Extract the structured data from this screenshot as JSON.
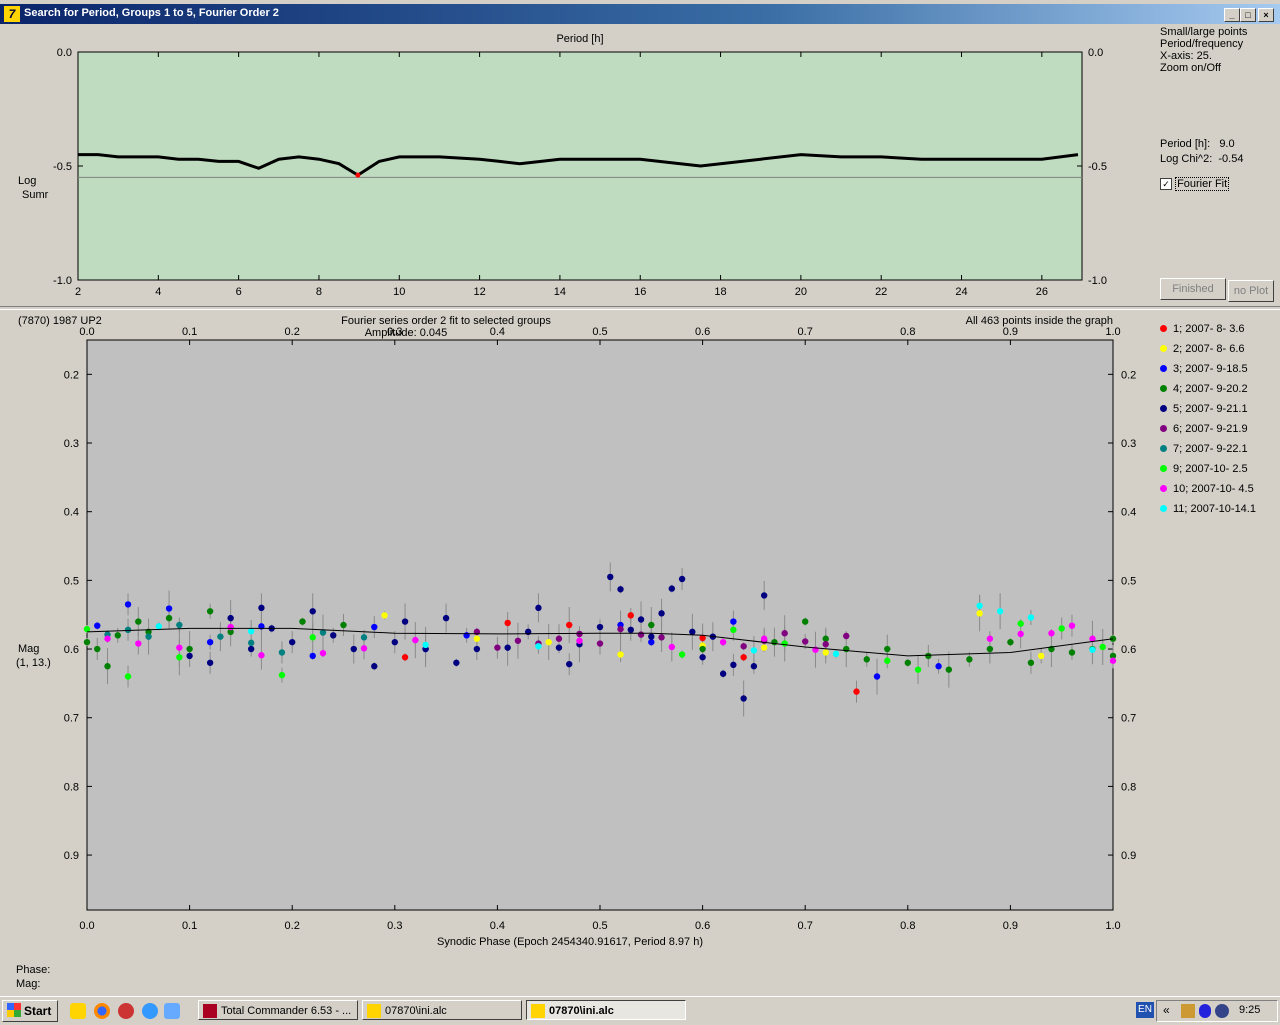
{
  "window": {
    "title": "Search for Period, Groups 1 to 5, Fourier Order 2"
  },
  "top_chart": {
    "xlabel": "Period [h]",
    "ylabel_line1": "Log",
    "ylabel_line2": "Sumr",
    "x_range": [
      2,
      27
    ],
    "y_range": [
      -1.0,
      0.0
    ],
    "x_ticks": [
      "2",
      "4",
      "6",
      "8",
      "10",
      "12",
      "14",
      "16",
      "18",
      "20",
      "22",
      "24",
      "26"
    ],
    "y_ticks": [
      "0.0",
      "-0.5",
      "-1.0"
    ],
    "min_marker": {
      "x": 8.97,
      "y": -0.54
    },
    "reference_y": -0.55,
    "bg_color": "#c0dcc0"
  },
  "side_top": {
    "menu": [
      "Small/large points",
      "Period/frequency",
      "X-axis: 25.",
      "Zoom on/Off"
    ],
    "period_label": "Period [h]:",
    "period_value": "9.0",
    "chi_label": "Log Chi^2:",
    "chi_value": "-0.54",
    "fourier_fit_label": "Fourier Fit",
    "finished_button": "Finished",
    "noplot_button": "no Plot"
  },
  "bottom_chart": {
    "object": "(7870) 1987 UP2",
    "title_line1": "Fourier series order 2 fit to selected groups",
    "title_line2": "Amplitude: 0.045",
    "status": "All 463 points inside the graph",
    "xlabel": "Synodic Phase (Epoch 2454340.91617, Period 8.97 h)",
    "ylabel_line1": "Mag",
    "ylabel_line2": "(1, 13.)",
    "x_range": [
      0.0,
      1.0
    ],
    "y_range": [
      0.15,
      0.98
    ],
    "x_ticks": [
      "0.0",
      "0.1",
      "0.2",
      "0.3",
      "0.4",
      "0.5",
      "0.6",
      "0.7",
      "0.8",
      "0.9",
      "1.0"
    ],
    "y_ticks": [
      "0.2",
      "0.3",
      "0.4",
      "0.5",
      "0.6",
      "0.7",
      "0.8",
      "0.9"
    ]
  },
  "legend": [
    {
      "label": "1; 2007- 8- 3.6",
      "color": "#ff0000"
    },
    {
      "label": "2; 2007- 8- 6.6",
      "color": "#ffff00"
    },
    {
      "label": "3; 2007- 9-18.5",
      "color": "#0000ff"
    },
    {
      "label": "4; 2007- 9-20.2",
      "color": "#008000"
    },
    {
      "label": "5; 2007- 9-21.1",
      "color": "#000080"
    },
    {
      "label": "6; 2007- 9-21.9",
      "color": "#800080"
    },
    {
      "label": "7; 2007- 9-22.1",
      "color": "#008080"
    },
    {
      "label": "9; 2007-10- 2.5",
      "color": "#00ff00"
    },
    {
      "label": "10; 2007-10- 4.5",
      "color": "#ff00ff"
    },
    {
      "label": "11; 2007-10-14.1",
      "color": "#00ffff"
    }
  ],
  "status_bottom": {
    "phase_label": "Phase:",
    "mag_label": "Mag:"
  },
  "taskbar": {
    "start": "Start",
    "tasks": [
      "Total Commander 6.53 - ...",
      "07870\\ini.alc",
      "07870\\ini.alc"
    ],
    "lang": "EN",
    "clock": "9:25"
  },
  "chart_data": [
    {
      "type": "line",
      "title": "",
      "xlabel": "Period [h]",
      "ylabel": "Log Sumr",
      "xlim": [
        2,
        27
      ],
      "ylim": [
        -1.0,
        0.0
      ],
      "series": [
        {
          "values": [
            [
              2.0,
              -0.45
            ],
            [
              2.5,
              -0.45
            ],
            [
              3.0,
              -0.46
            ],
            [
              3.5,
              -0.46
            ],
            [
              4.0,
              -0.46
            ],
            [
              4.5,
              -0.47
            ],
            [
              5.0,
              -0.47
            ],
            [
              5.5,
              -0.48
            ],
            [
              6.0,
              -0.48
            ],
            [
              6.5,
              -0.51
            ],
            [
              7.0,
              -0.47
            ],
            [
              7.5,
              -0.46
            ],
            [
              8.0,
              -0.47
            ],
            [
              8.5,
              -0.49
            ],
            [
              8.97,
              -0.54
            ],
            [
              9.5,
              -0.48
            ],
            [
              10.0,
              -0.46
            ],
            [
              11.0,
              -0.46
            ],
            [
              12.0,
              -0.47
            ],
            [
              12.5,
              -0.48
            ],
            [
              13.0,
              -0.49
            ],
            [
              14.0,
              -0.47
            ],
            [
              15.0,
              -0.47
            ],
            [
              16.0,
              -0.47
            ],
            [
              17.0,
              -0.49
            ],
            [
              17.5,
              -0.5
            ],
            [
              18.0,
              -0.49
            ],
            [
              19.0,
              -0.47
            ],
            [
              20.0,
              -0.45
            ],
            [
              21.0,
              -0.46
            ],
            [
              22.0,
              -0.46
            ],
            [
              23.0,
              -0.47
            ],
            [
              24.0,
              -0.47
            ],
            [
              25.0,
              -0.47
            ],
            [
              26.0,
              -0.47
            ],
            [
              26.9,
              -0.45
            ]
          ]
        }
      ]
    },
    {
      "type": "scatter",
      "title": "Fourier series order 2 fit to selected groups",
      "xlabel": "Synodic Phase (Epoch 2454340.91617, Period 8.97 h)",
      "ylabel": "Mag (1, 13.)",
      "xlim": [
        0.0,
        1.0
      ],
      "ylim": [
        0.15,
        0.98
      ],
      "series": [
        {
          "name": "1; 2007- 8- 3.6",
          "color": "#ff0000",
          "values": [
            [
              0.31,
              0.612
            ],
            [
              0.41,
              0.562
            ],
            [
              0.47,
              0.565
            ],
            [
              0.53,
              0.551
            ],
            [
              0.6,
              0.584
            ],
            [
              0.64,
              0.612
            ],
            [
              0.75,
              0.662
            ]
          ]
        },
        {
          "name": "2; 2007- 8- 6.6",
          "color": "#ffff00",
          "values": [
            [
              0.29,
              0.551
            ],
            [
              0.38,
              0.585
            ],
            [
              0.45,
              0.59
            ],
            [
              0.52,
              0.608
            ],
            [
              0.6,
              0.595
            ],
            [
              0.66,
              0.598
            ],
            [
              0.72,
              0.605
            ],
            [
              0.87,
              0.548
            ],
            [
              0.93,
              0.61
            ]
          ]
        },
        {
          "name": "3; 2007- 9-18.5",
          "color": "#0000ff",
          "values": [
            [
              0.01,
              0.566
            ],
            [
              0.04,
              0.535
            ],
            [
              0.08,
              0.541
            ],
            [
              0.12,
              0.59
            ],
            [
              0.17,
              0.567
            ],
            [
              0.22,
              0.61
            ],
            [
              0.28,
              0.568
            ],
            [
              0.33,
              0.6
            ],
            [
              0.37,
              0.58
            ],
            [
              0.52,
              0.565
            ],
            [
              0.55,
              0.59
            ],
            [
              0.63,
              0.56
            ],
            [
              0.77,
              0.64
            ],
            [
              0.83,
              0.625
            ]
          ]
        },
        {
          "name": "4; 2007- 9-20.2",
          "color": "#008000",
          "values": [
            [
              0.0,
              0.59
            ],
            [
              0.01,
              0.6
            ],
            [
              0.02,
              0.625
            ],
            [
              0.03,
              0.58
            ],
            [
              0.05,
              0.56
            ],
            [
              0.06,
              0.575
            ],
            [
              0.08,
              0.555
            ],
            [
              0.1,
              0.6
            ],
            [
              0.12,
              0.545
            ],
            [
              0.14,
              0.575
            ],
            [
              0.21,
              0.56
            ],
            [
              0.25,
              0.565
            ],
            [
              0.55,
              0.565
            ],
            [
              0.6,
              0.6
            ],
            [
              0.67,
              0.59
            ],
            [
              0.7,
              0.56
            ],
            [
              0.72,
              0.585
            ],
            [
              0.74,
              0.6
            ],
            [
              0.76,
              0.615
            ],
            [
              0.78,
              0.6
            ],
            [
              0.8,
              0.62
            ],
            [
              0.82,
              0.61
            ],
            [
              0.84,
              0.63
            ],
            [
              0.86,
              0.615
            ],
            [
              0.88,
              0.6
            ],
            [
              0.9,
              0.59
            ],
            [
              0.92,
              0.62
            ],
            [
              0.94,
              0.6
            ],
            [
              0.96,
              0.605
            ],
            [
              0.98,
              0.6
            ],
            [
              1.0,
              0.585
            ],
            [
              1.0,
              0.61
            ]
          ]
        },
        {
          "name": "5; 2007- 9-21.1",
          "color": "#000080",
          "values": [
            [
              0.1,
              0.61
            ],
            [
              0.12,
              0.62
            ],
            [
              0.14,
              0.555
            ],
            [
              0.16,
              0.6
            ],
            [
              0.17,
              0.54
            ],
            [
              0.18,
              0.57
            ],
            [
              0.2,
              0.59
            ],
            [
              0.22,
              0.545
            ],
            [
              0.24,
              0.58
            ],
            [
              0.26,
              0.6
            ],
            [
              0.28,
              0.625
            ],
            [
              0.3,
              0.59
            ],
            [
              0.31,
              0.56
            ],
            [
              0.33,
              0.6
            ],
            [
              0.35,
              0.555
            ],
            [
              0.36,
              0.62
            ],
            [
              0.38,
              0.6
            ],
            [
              0.41,
              0.598
            ],
            [
              0.43,
              0.575
            ],
            [
              0.44,
              0.54
            ],
            [
              0.46,
              0.598
            ],
            [
              0.47,
              0.622
            ],
            [
              0.48,
              0.593
            ],
            [
              0.5,
              0.568
            ],
            [
              0.51,
              0.495
            ],
            [
              0.52,
              0.513
            ],
            [
              0.53,
              0.572
            ],
            [
              0.54,
              0.557
            ],
            [
              0.55,
              0.582
            ],
            [
              0.56,
              0.548
            ],
            [
              0.57,
              0.512
            ],
            [
              0.58,
              0.498
            ],
            [
              0.59,
              0.575
            ],
            [
              0.6,
              0.612
            ],
            [
              0.61,
              0.582
            ],
            [
              0.62,
              0.636
            ],
            [
              0.63,
              0.623
            ],
            [
              0.64,
              0.672
            ],
            [
              0.65,
              0.625
            ],
            [
              0.66,
              0.522
            ]
          ]
        },
        {
          "name": "6; 2007- 9-21.9",
          "color": "#800080",
          "values": [
            [
              0.38,
              0.575
            ],
            [
              0.4,
              0.598
            ],
            [
              0.42,
              0.588
            ],
            [
              0.44,
              0.592
            ],
            [
              0.46,
              0.585
            ],
            [
              0.48,
              0.578
            ],
            [
              0.5,
              0.592
            ],
            [
              0.52,
              0.571
            ],
            [
              0.54,
              0.579
            ],
            [
              0.56,
              0.583
            ],
            [
              0.64,
              0.596
            ],
            [
              0.66,
              0.588
            ],
            [
              0.68,
              0.577
            ],
            [
              0.7,
              0.589
            ],
            [
              0.72,
              0.593
            ],
            [
              0.74,
              0.581
            ]
          ]
        },
        {
          "name": "7; 2007- 9-22.1",
          "color": "#008080",
          "values": [
            [
              0.02,
              0.579
            ],
            [
              0.04,
              0.572
            ],
            [
              0.06,
              0.582
            ],
            [
              0.09,
              0.565
            ],
            [
              0.13,
              0.582
            ],
            [
              0.16,
              0.591
            ],
            [
              0.19,
              0.605
            ],
            [
              0.23,
              0.576
            ],
            [
              0.27,
              0.583
            ]
          ]
        },
        {
          "name": "9; 2007-10- 2.5",
          "color": "#00ff00",
          "values": [
            [
              0.0,
              0.571
            ],
            [
              0.04,
              0.64
            ],
            [
              0.09,
              0.612
            ],
            [
              0.19,
              0.638
            ],
            [
              0.22,
              0.583
            ],
            [
              0.58,
              0.608
            ],
            [
              0.63,
              0.572
            ],
            [
              0.68,
              0.592
            ],
            [
              0.78,
              0.617
            ],
            [
              0.81,
              0.63
            ],
            [
              0.91,
              0.563
            ],
            [
              0.95,
              0.57
            ],
            [
              0.99,
              0.597
            ]
          ]
        },
        {
          "name": "10; 2007-10- 4.5",
          "color": "#ff00ff",
          "values": [
            [
              0.02,
              0.585
            ],
            [
              0.05,
              0.592
            ],
            [
              0.09,
              0.598
            ],
            [
              0.14,
              0.568
            ],
            [
              0.17,
              0.609
            ],
            [
              0.23,
              0.606
            ],
            [
              0.27,
              0.599
            ],
            [
              0.32,
              0.587
            ],
            [
              0.48,
              0.588
            ],
            [
              0.57,
              0.597
            ],
            [
              0.62,
              0.59
            ],
            [
              0.66,
              0.585
            ],
            [
              0.71,
              0.601
            ],
            [
              0.88,
              0.585
            ],
            [
              0.91,
              0.578
            ],
            [
              0.94,
              0.577
            ],
            [
              0.96,
              0.566
            ],
            [
              0.98,
              0.585
            ],
            [
              1.0,
              0.617
            ]
          ]
        },
        {
          "name": "11; 2007-10-14.1",
          "color": "#00ffff",
          "values": [
            [
              0.07,
              0.567
            ],
            [
              0.16,
              0.574
            ],
            [
              0.33,
              0.594
            ],
            [
              0.44,
              0.596
            ],
            [
              0.65,
              0.602
            ],
            [
              0.73,
              0.607
            ],
            [
              0.87,
              0.537
            ],
            [
              0.89,
              0.545
            ],
            [
              0.92,
              0.554
            ],
            [
              0.98,
              0.601
            ]
          ]
        }
      ],
      "fit_curve": [
        [
          0.0,
          0.575
        ],
        [
          0.1,
          0.57
        ],
        [
          0.2,
          0.57
        ],
        [
          0.3,
          0.577
        ],
        [
          0.4,
          0.578
        ],
        [
          0.5,
          0.577
        ],
        [
          0.55,
          0.577
        ],
        [
          0.6,
          0.58
        ],
        [
          0.7,
          0.597
        ],
        [
          0.8,
          0.61
        ],
        [
          0.9,
          0.605
        ],
        [
          1.0,
          0.585
        ]
      ]
    }
  ]
}
